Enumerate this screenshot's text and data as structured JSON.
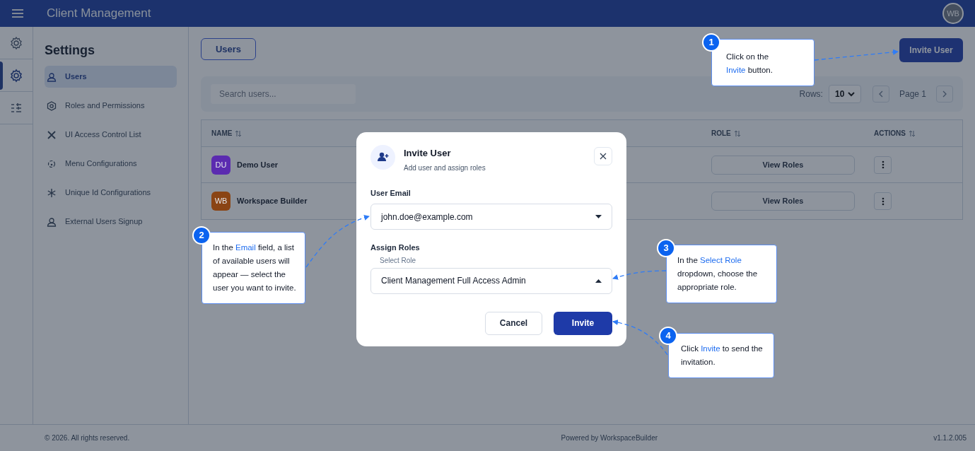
{
  "app_bar": {
    "title": "Client Management",
    "avatar": "WB"
  },
  "rail": [
    {
      "selected": false
    },
    {
      "selected": true
    },
    {
      "selected": false
    }
  ],
  "sidebar": {
    "title": "Settings",
    "items": [
      {
        "label": "Users",
        "selected": true
      },
      {
        "label": "Roles and Permissions",
        "selected": false
      },
      {
        "label": "UI Access Control List",
        "selected": false
      },
      {
        "label": "Menu Configurations",
        "selected": false
      },
      {
        "label": "Unique Id Configurations",
        "selected": false
      },
      {
        "label": "External Users Signup",
        "selected": false
      }
    ]
  },
  "page_tab": "Users",
  "invite_button": "Invite User",
  "search": {
    "placeholder": "Search users..."
  },
  "pagination": {
    "rows_label": "Rows:",
    "rows_value": "10",
    "page": "Page 1"
  },
  "table": {
    "columns": [
      "NAME",
      "ROLE",
      "ACTIONS"
    ],
    "rows": [
      {
        "initials": "DU",
        "color": "#5b2bb0",
        "name": "Demo User",
        "role_button": "View Roles"
      },
      {
        "initials": "WB",
        "color": "#8a4414",
        "name": "Workspace Builder",
        "role_button": "View Roles"
      }
    ]
  },
  "dialog": {
    "title": "Invite User",
    "subtitle": "Add user and assign roles",
    "email_label": "User Email",
    "email_value": "john.doe@example.com",
    "roles_label": "Assign Roles",
    "role_field_label": "Select Role",
    "role_value": "Client Management Full Access Admin",
    "role_expanded": true,
    "cancel": "Cancel",
    "invite": "Invite"
  },
  "callouts": [
    {
      "number": "1",
      "parts": [
        {
          "text": "Click on the "
        },
        {
          "text": "Invite",
          "highlight": true
        },
        {
          "text": " button."
        }
      ]
    },
    {
      "number": "2",
      "parts": [
        {
          "text": "In the "
        },
        {
          "text": "Email",
          "highlight": true
        },
        {
          "text": " field, a list of available users will appear — select the user you want to invite."
        }
      ]
    },
    {
      "number": "3",
      "parts": [
        {
          "text": "In the "
        },
        {
          "text": "Select Role",
          "highlight": true
        },
        {
          "text": " dropdown, choose the appropriate role."
        }
      ]
    },
    {
      "number": "4",
      "parts": [
        {
          "text": "Click "
        },
        {
          "text": "Invite",
          "highlight": true
        },
        {
          "text": " to send the invitation."
        }
      ]
    }
  ],
  "footer": {
    "copyright": "© 2026. All rights reserved.",
    "powered": "Powered by WorkspaceBuilder",
    "version": "v1.1.2.005"
  }
}
